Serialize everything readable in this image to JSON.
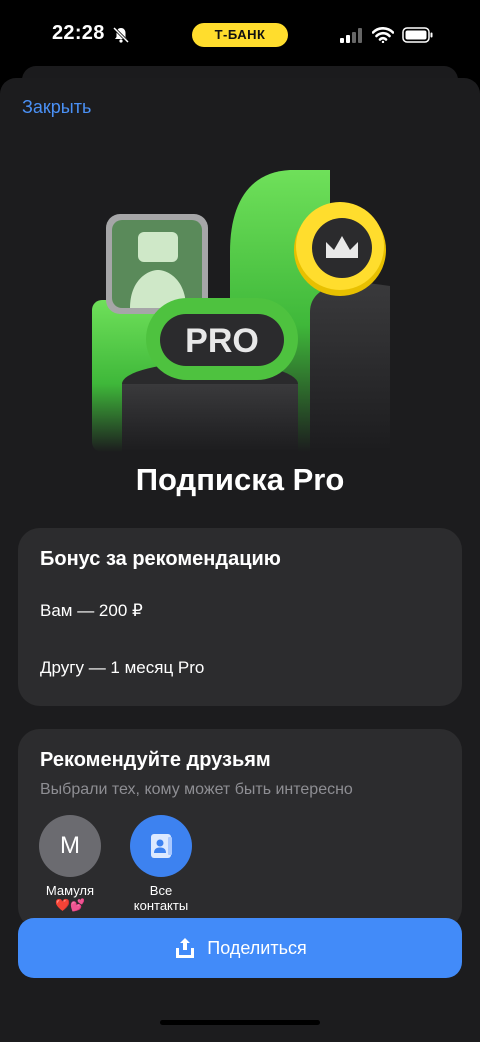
{
  "status_bar": {
    "time": "22:28",
    "bank_name": "Т-БАНК",
    "icons": [
      "bell-slash-icon",
      "signal-icon",
      "wifi-icon",
      "battery-icon"
    ]
  },
  "header": {
    "close_label": "Закрыть"
  },
  "hero": {
    "badge_text": "PRO",
    "icons": [
      "profile-card-icon",
      "crown-coin-icon"
    ]
  },
  "title": "Подписка Pro",
  "bonus_card": {
    "title": "Бонус за рекомендацию",
    "you": "Вам — 200 ₽",
    "friend": "Другу — 1 месяц Pro"
  },
  "recommend_card": {
    "title": "Рекомендуйте друзьям",
    "subtitle": "Выбрали тех, кому может быть интересно",
    "contacts": [
      {
        "initial": "М",
        "name": "Мамуля",
        "emoji": "❤️💕"
      },
      {
        "icon": "contacts-book-icon",
        "name_line1": "Все",
        "name_line2": "контакты"
      }
    ]
  },
  "share_button": {
    "label": "Поделиться",
    "icon": "share-upload-icon"
  },
  "colors": {
    "accent": "#428bf9",
    "link": "#4a90f5",
    "bank_yellow": "#ffdd2d",
    "card_bg": "#2c2c2e",
    "sheet_bg": "#1c1c1e"
  }
}
